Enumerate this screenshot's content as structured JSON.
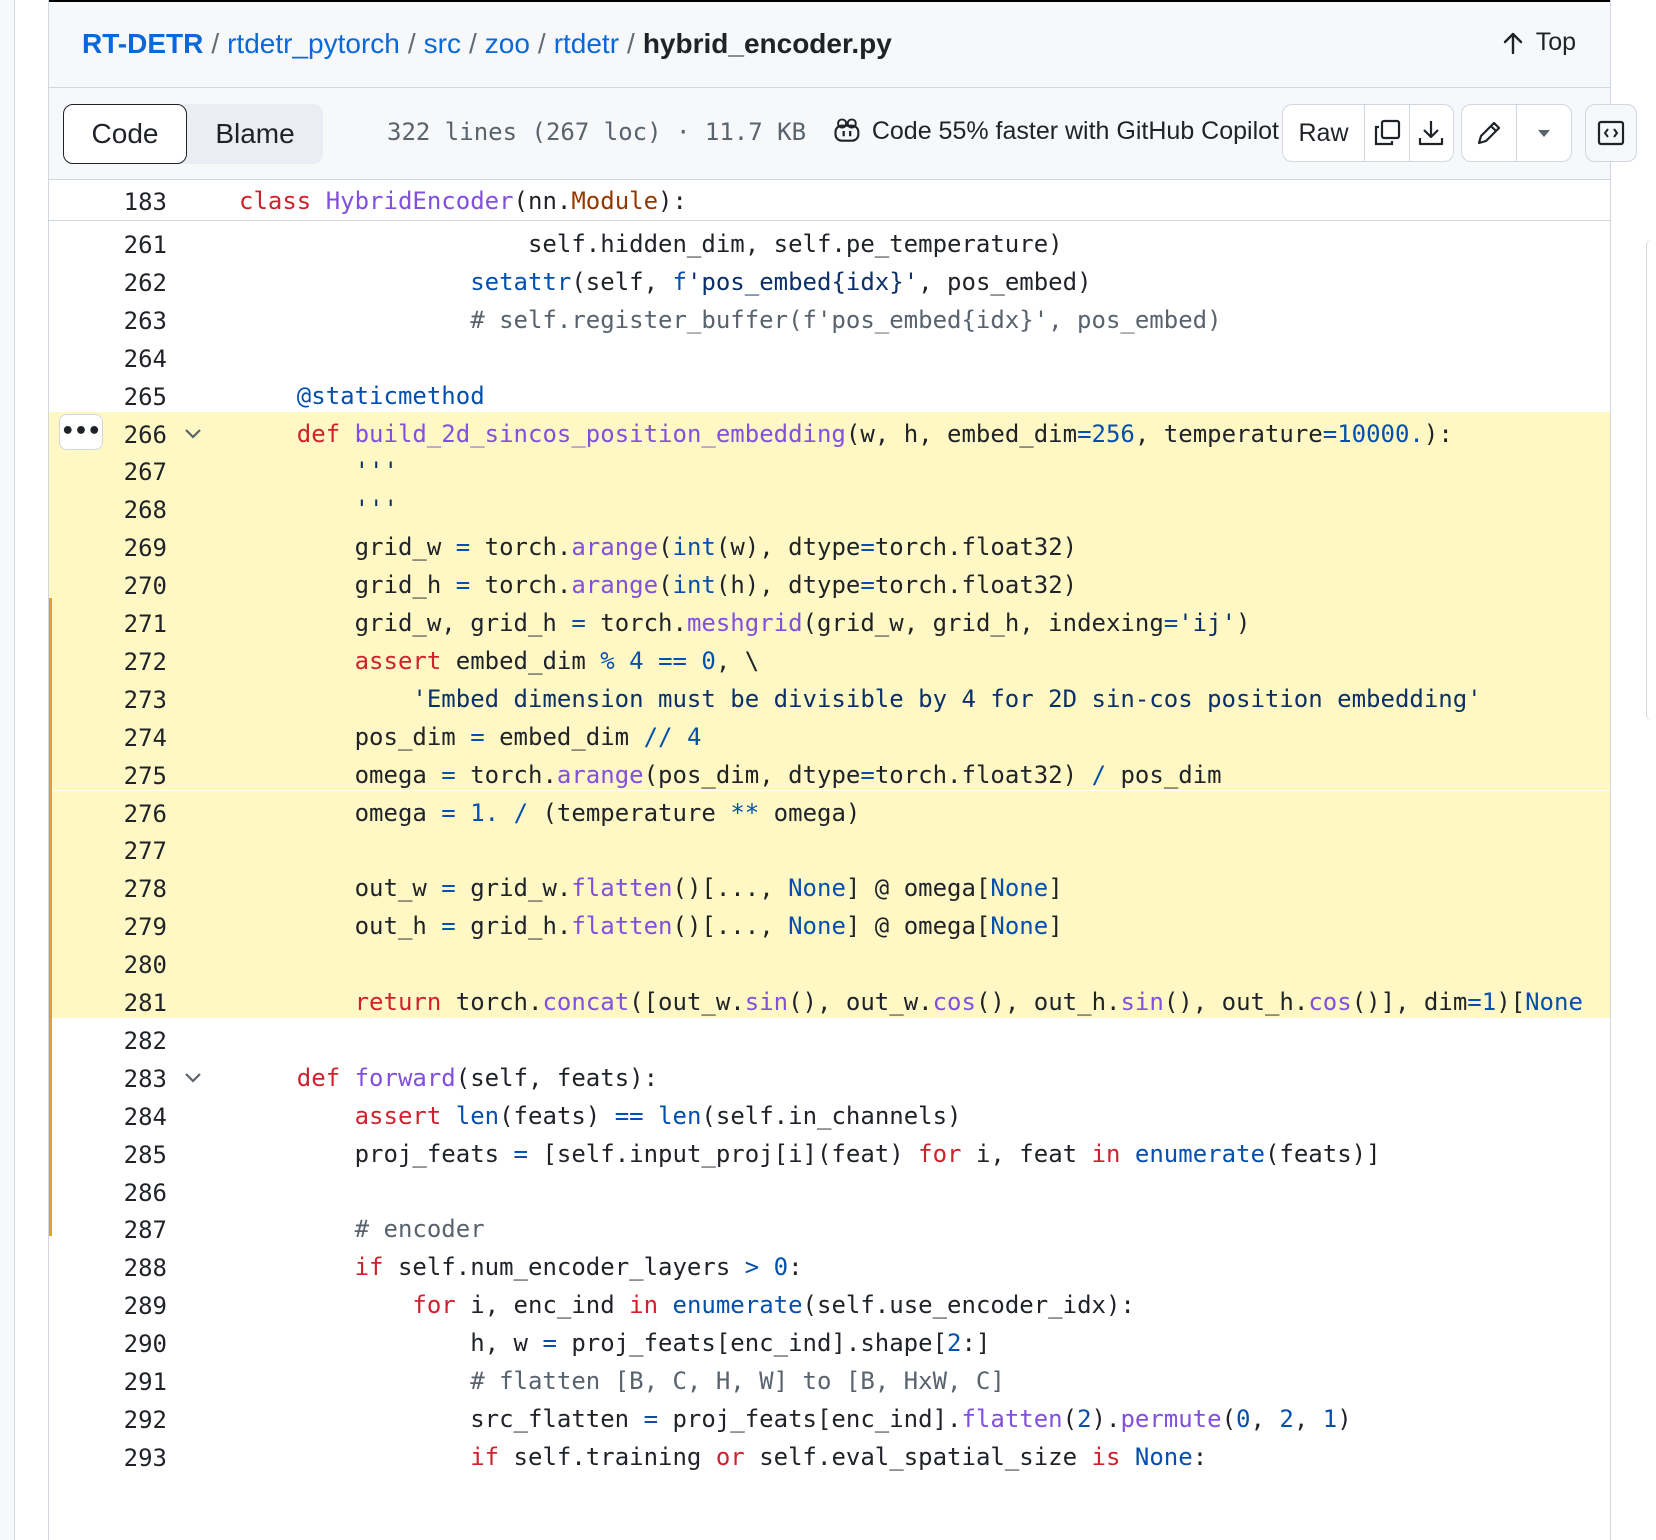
{
  "breadcrumb": {
    "items": [
      "RT-DETR",
      "rtdetr_pytorch",
      "src",
      "zoo",
      "rtdetr"
    ],
    "separator": "/",
    "file": "hybrid_encoder.py"
  },
  "top_button": {
    "label": "Top",
    "icon": "arrow-up-icon"
  },
  "toolbar": {
    "code_tab": "Code",
    "blame_tab": "Blame",
    "file_meta": "322 lines (267 loc) · 11.7 KB",
    "copilot_text": "Code 55% faster with GitHub Copilot",
    "raw_label": "Raw",
    "icons": [
      "copilot-icon",
      "copy-icon",
      "download-icon",
      "pencil-icon",
      "caret-down-icon",
      "symbols-icon"
    ]
  },
  "sticky_line": {
    "number": "183",
    "code": "class HybridEncoder(nn.Module):"
  },
  "colors": {
    "highlight_bg": "#fff8c5",
    "highlight_bar": "#d4a72c",
    "link": "#0969da",
    "keyword": "#cf222e",
    "function": "#8250df",
    "number": "#0550ae",
    "comment": "#59636e"
  },
  "lines": [
    {
      "n": "261",
      "code": "                    self.hidden_dim, self.pe_temperature)"
    },
    {
      "n": "262",
      "code": "                setattr(self, f'pos_embed{idx}', pos_embed)"
    },
    {
      "n": "263",
      "code": "                # self.register_buffer(f'pos_embed{idx}', pos_embed)"
    },
    {
      "n": "264",
      "code": ""
    },
    {
      "n": "265",
      "code": "    @staticmethod"
    },
    {
      "n": "266",
      "code": "    def build_2d_sincos_position_embedding(w, h, embed_dim=256, temperature=10000.):",
      "hl": true,
      "fold": true
    },
    {
      "n": "267",
      "code": "        '''",
      "hl": true
    },
    {
      "n": "268",
      "code": "        '''",
      "hl": true
    },
    {
      "n": "269",
      "code": "        grid_w = torch.arange(int(w), dtype=torch.float32)",
      "hl": true
    },
    {
      "n": "270",
      "code": "        grid_h = torch.arange(int(h), dtype=torch.float32)",
      "hl": true
    },
    {
      "n": "271",
      "code": "        grid_w, grid_h = torch.meshgrid(grid_w, grid_h, indexing='ij')",
      "hl": true
    },
    {
      "n": "272",
      "code": "        assert embed_dim % 4 == 0, \\",
      "hl": true
    },
    {
      "n": "273",
      "code": "            'Embed dimension must be divisible by 4 for 2D sin-cos position embedding'",
      "hl": true
    },
    {
      "n": "274",
      "code": "        pos_dim = embed_dim // 4",
      "hl": true
    },
    {
      "n": "275",
      "code": "        omega = torch.arange(pos_dim, dtype=torch.float32) / pos_dim",
      "hl": true
    },
    {
      "n": "276",
      "code": "        omega = 1. / (temperature ** omega)",
      "hl": true
    },
    {
      "n": "277",
      "code": "",
      "hl": true
    },
    {
      "n": "278",
      "code": "        out_w = grid_w.flatten()[..., None] @ omega[None]",
      "hl": true
    },
    {
      "n": "279",
      "code": "        out_h = grid_h.flatten()[..., None] @ omega[None]",
      "hl": true
    },
    {
      "n": "280",
      "code": "",
      "hl": true
    },
    {
      "n": "281",
      "code": "        return torch.concat([out_w.sin(), out_w.cos(), out_h.sin(), out_h.cos()], dim=1)[None",
      "hl": true
    },
    {
      "n": "282",
      "code": ""
    },
    {
      "n": "283",
      "code": "    def forward(self, feats):",
      "fold": true
    },
    {
      "n": "284",
      "code": "        assert len(feats) == len(self.in_channels)"
    },
    {
      "n": "285",
      "code": "        proj_feats = [self.input_proj[i](feat) for i, feat in enumerate(feats)]"
    },
    {
      "n": "286",
      "code": ""
    },
    {
      "n": "287",
      "code": "        # encoder"
    },
    {
      "n": "288",
      "code": "        if self.num_encoder_layers > 0:"
    },
    {
      "n": "289",
      "code": "            for i, enc_ind in enumerate(self.use_encoder_idx):"
    },
    {
      "n": "290",
      "code": "                h, w = proj_feats[enc_ind].shape[2:]"
    },
    {
      "n": "291",
      "code": "                # flatten [B, C, H, W] to [B, HxW, C]"
    },
    {
      "n": "292",
      "code": "                src_flatten = proj_feats[enc_ind].flatten(2).permute(0, 2, 1)"
    },
    {
      "n": "293",
      "code": "                if self.training or self.eval_spatial_size is None:"
    }
  ]
}
